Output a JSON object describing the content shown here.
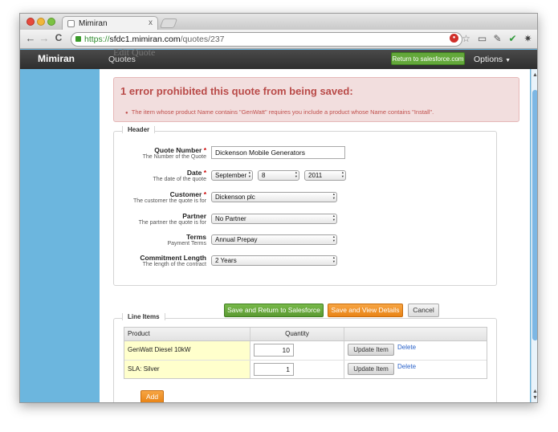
{
  "browser": {
    "tab_title": "Mimiran",
    "url_scheme": "https://",
    "url_host": "sfdc1.mimiran.com",
    "url_path": "/quotes/237",
    "nav_back": "←",
    "nav_forward": "→",
    "nav_reload": "C",
    "tab_close": "x"
  },
  "app": {
    "brand": "Mimiran",
    "nav_quotes": "Quotes",
    "ghost_title": "Edit Quote",
    "return_button": "Return to salesforce.com",
    "options": "Options"
  },
  "error": {
    "heading": "1 error prohibited this quote from being saved:",
    "message": "The item whose product Name contains \"GenWatt\" requires you include a product whose Name contains \"Install\"."
  },
  "header_section": {
    "legend": "Header",
    "quote_number": {
      "label": "Quote Number",
      "hint": "The Number of the Quote",
      "value": "Dickenson Mobile Generators"
    },
    "date": {
      "label": "Date",
      "hint": "The date of the quote",
      "month": "September",
      "day": "8",
      "year": "2011"
    },
    "customer": {
      "label": "Customer",
      "hint": "The customer the quote is for",
      "value": "Dickenson plc"
    },
    "partner": {
      "label": "Partner",
      "hint": "The partner the quote is for",
      "value": "No Partner"
    },
    "terms": {
      "label": "Terms",
      "hint": "Payment Terms",
      "value": "Annual Prepay"
    },
    "commitment": {
      "label": "Commitment Length",
      "hint": "The length of the contract",
      "value": "2 Years"
    },
    "required_mark": "*"
  },
  "actions": {
    "save_return": "Save and Return to Salesforce",
    "save_view": "Save and View Details",
    "cancel": "Cancel"
  },
  "line_items": {
    "legend": "Line Items",
    "col_product": "Product",
    "col_quantity": "Quantity",
    "rows": [
      {
        "product": "GenWatt Diesel 10kW",
        "quantity": "10",
        "update": "Update Item",
        "delete": "Delete"
      },
      {
        "product": "SLA: Silver",
        "quantity": "1",
        "update": "Update Item",
        "delete": "Delete"
      }
    ],
    "add": "Add"
  }
}
